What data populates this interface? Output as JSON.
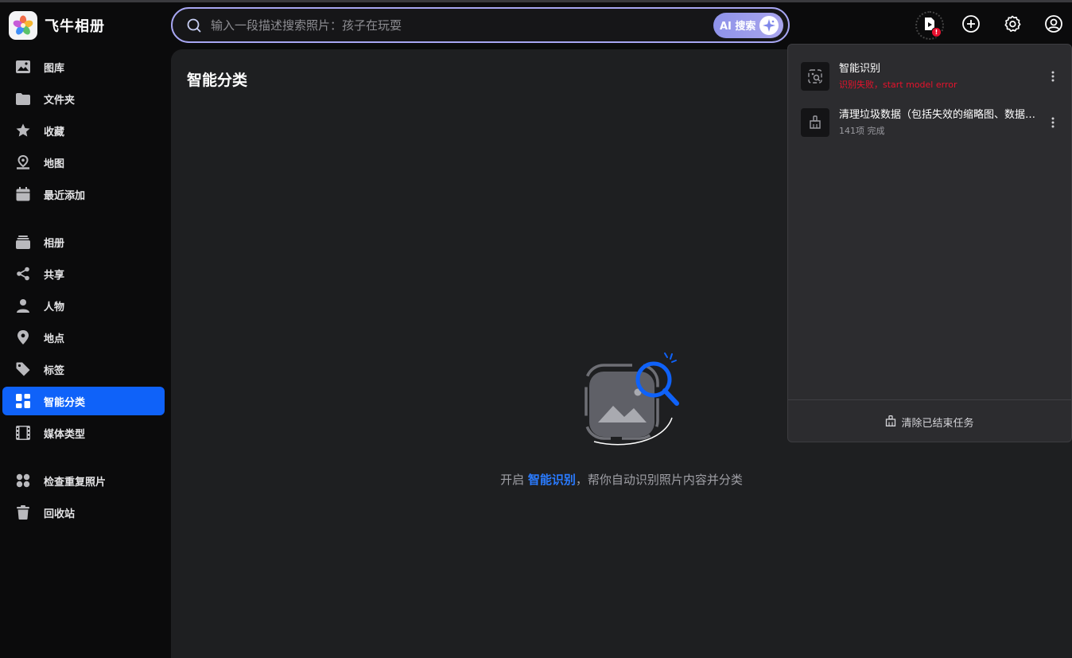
{
  "app": {
    "title": "飞牛相册"
  },
  "search": {
    "placeholder": "输入一段描述搜索照片：孩子在玩耍",
    "ai_button_label": "AI 搜索"
  },
  "header": {
    "task_badge": "!",
    "icons": [
      "task-list-icon",
      "plus-circle-icon",
      "gear-icon",
      "user-circle-icon"
    ]
  },
  "sidebar": {
    "items": [
      {
        "label": "图库",
        "icon": "image-icon"
      },
      {
        "label": "文件夹",
        "icon": "folder-icon"
      },
      {
        "label": "收藏",
        "icon": "star-icon"
      },
      {
        "label": "地图",
        "icon": "map-pin-icon"
      },
      {
        "label": "最近添加",
        "icon": "calendar-icon"
      },
      {
        "label": "相册",
        "icon": "album-icon"
      },
      {
        "label": "共享",
        "icon": "share-icon"
      },
      {
        "label": "人物",
        "icon": "person-icon"
      },
      {
        "label": "地点",
        "icon": "location-icon"
      },
      {
        "label": "标签",
        "icon": "tag-icon"
      },
      {
        "label": "智能分类",
        "icon": "grid-icon",
        "active": true
      },
      {
        "label": "媒体类型",
        "icon": "film-icon"
      },
      {
        "label": "检查重复照片",
        "icon": "duplicate-icon"
      },
      {
        "label": "回收站",
        "icon": "trash-icon"
      }
    ]
  },
  "main": {
    "title": "智能分类",
    "empty_prefix": "开启 ",
    "empty_link": "智能识别",
    "empty_suffix": "，帮你自动识别照片内容并分类"
  },
  "tasks": {
    "items": [
      {
        "title": "智能识别",
        "status": "识别失败，start model error",
        "status_type": "error",
        "icon": "scan-image-icon"
      },
      {
        "title": "清理垃圾数据（包括失效的缩略图、数据库记录等）",
        "status": "141项 完成",
        "status_type": "ok",
        "icon": "broom-icon"
      }
    ],
    "clear_label": "清除已结束任务"
  },
  "colors": {
    "accent": "#0f62f9",
    "ai_gradient_start": "#8f93ea",
    "error": "#e8122c",
    "background": "#0b0b0c",
    "panel": "#1e1f21"
  }
}
